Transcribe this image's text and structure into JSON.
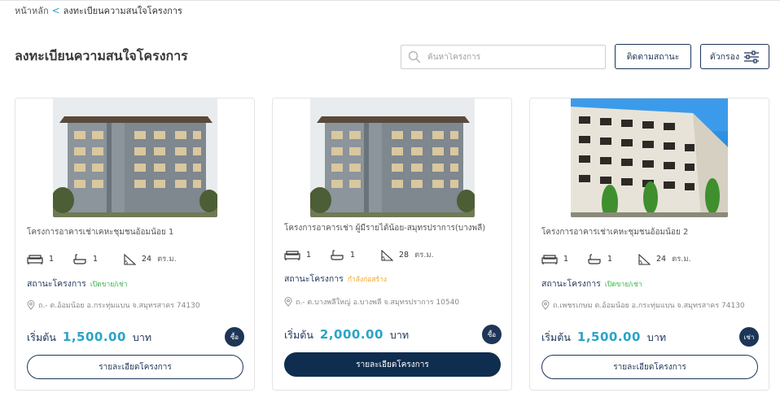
{
  "breadcrumb": {
    "home": "หน้าหลัก",
    "separator": "<",
    "current": "ลงทะเบียนความสนใจโครงการ"
  },
  "page": {
    "title": "ลงทะเบียนความสนใจโครงการ"
  },
  "search": {
    "placeholder": "ค้นหาโครงการ",
    "icon": "search-icon"
  },
  "buttons": {
    "follow_status": "ติดตามสถานะ",
    "filter": "ตัวกรอง",
    "filter_icon": "sliders-icon"
  },
  "colors": {
    "navy": "#1d3557",
    "accent": "#2aa4c6",
    "status_open": "#3bb54a",
    "status_building": "#f5a623"
  },
  "projects": [
    {
      "name": "โครงการอาคารเช่าเคหะชุมชนอ้อมน้อย 1",
      "bedrooms": "1",
      "bathrooms": "1",
      "area": "24",
      "area_unit": "ตร.ม.",
      "status_label": "สถานะโครงการ",
      "status_value": "เปิดขาย/เช่า",
      "status_color": "#3bb54a",
      "address": "ถ.- ต.อ้อมน้อย อ.กระทุ่มแบน จ.สมุทรสาคร 74130",
      "price_label": "เริ่มต้น",
      "price": "1,500.00",
      "price_unit": "บาท",
      "type_badge": "ซื้อ",
      "detail_button": "รายละเอียดโครงการ"
    },
    {
      "name": "โครงการอาคารเช่า ผู้มีรายได้น้อย-สมุทรปราการ(บางพลี)",
      "bedrooms": "1",
      "bathrooms": "1",
      "area": "28",
      "area_unit": "ตร.ม.",
      "status_label": "สถานะโครงการ",
      "status_value": "กำลังก่อสร้าง",
      "status_color": "#f5a623",
      "address": "ถ.- ต.บางพลีใหญ่ อ.บางพลี จ.สมุทรปราการ 10540",
      "price_label": "เริ่มต้น",
      "price": "2,000.00",
      "price_unit": "บาท",
      "type_badge": "ซื้อ",
      "detail_button": "รายละเอียดโครงการ"
    },
    {
      "name": "โครงการอาคารเช่าเคหะชุมชนอ้อมน้อย 2",
      "bedrooms": "1",
      "bathrooms": "1",
      "area": "24",
      "area_unit": "ตร.ม.",
      "status_label": "สถานะโครงการ",
      "status_value": "เปิดขาย/เช่า",
      "status_color": "#3bb54a",
      "address": "ถ.เพชรเกษม ต.อ้อมน้อย อ.กระทุ่มแบน จ.สมุทรสาคร 74130",
      "price_label": "เริ่มต้น",
      "price": "1,500.00",
      "price_unit": "บาท",
      "type_badge": "เช่า",
      "detail_button": "รายละเอียดโครงการ"
    }
  ]
}
